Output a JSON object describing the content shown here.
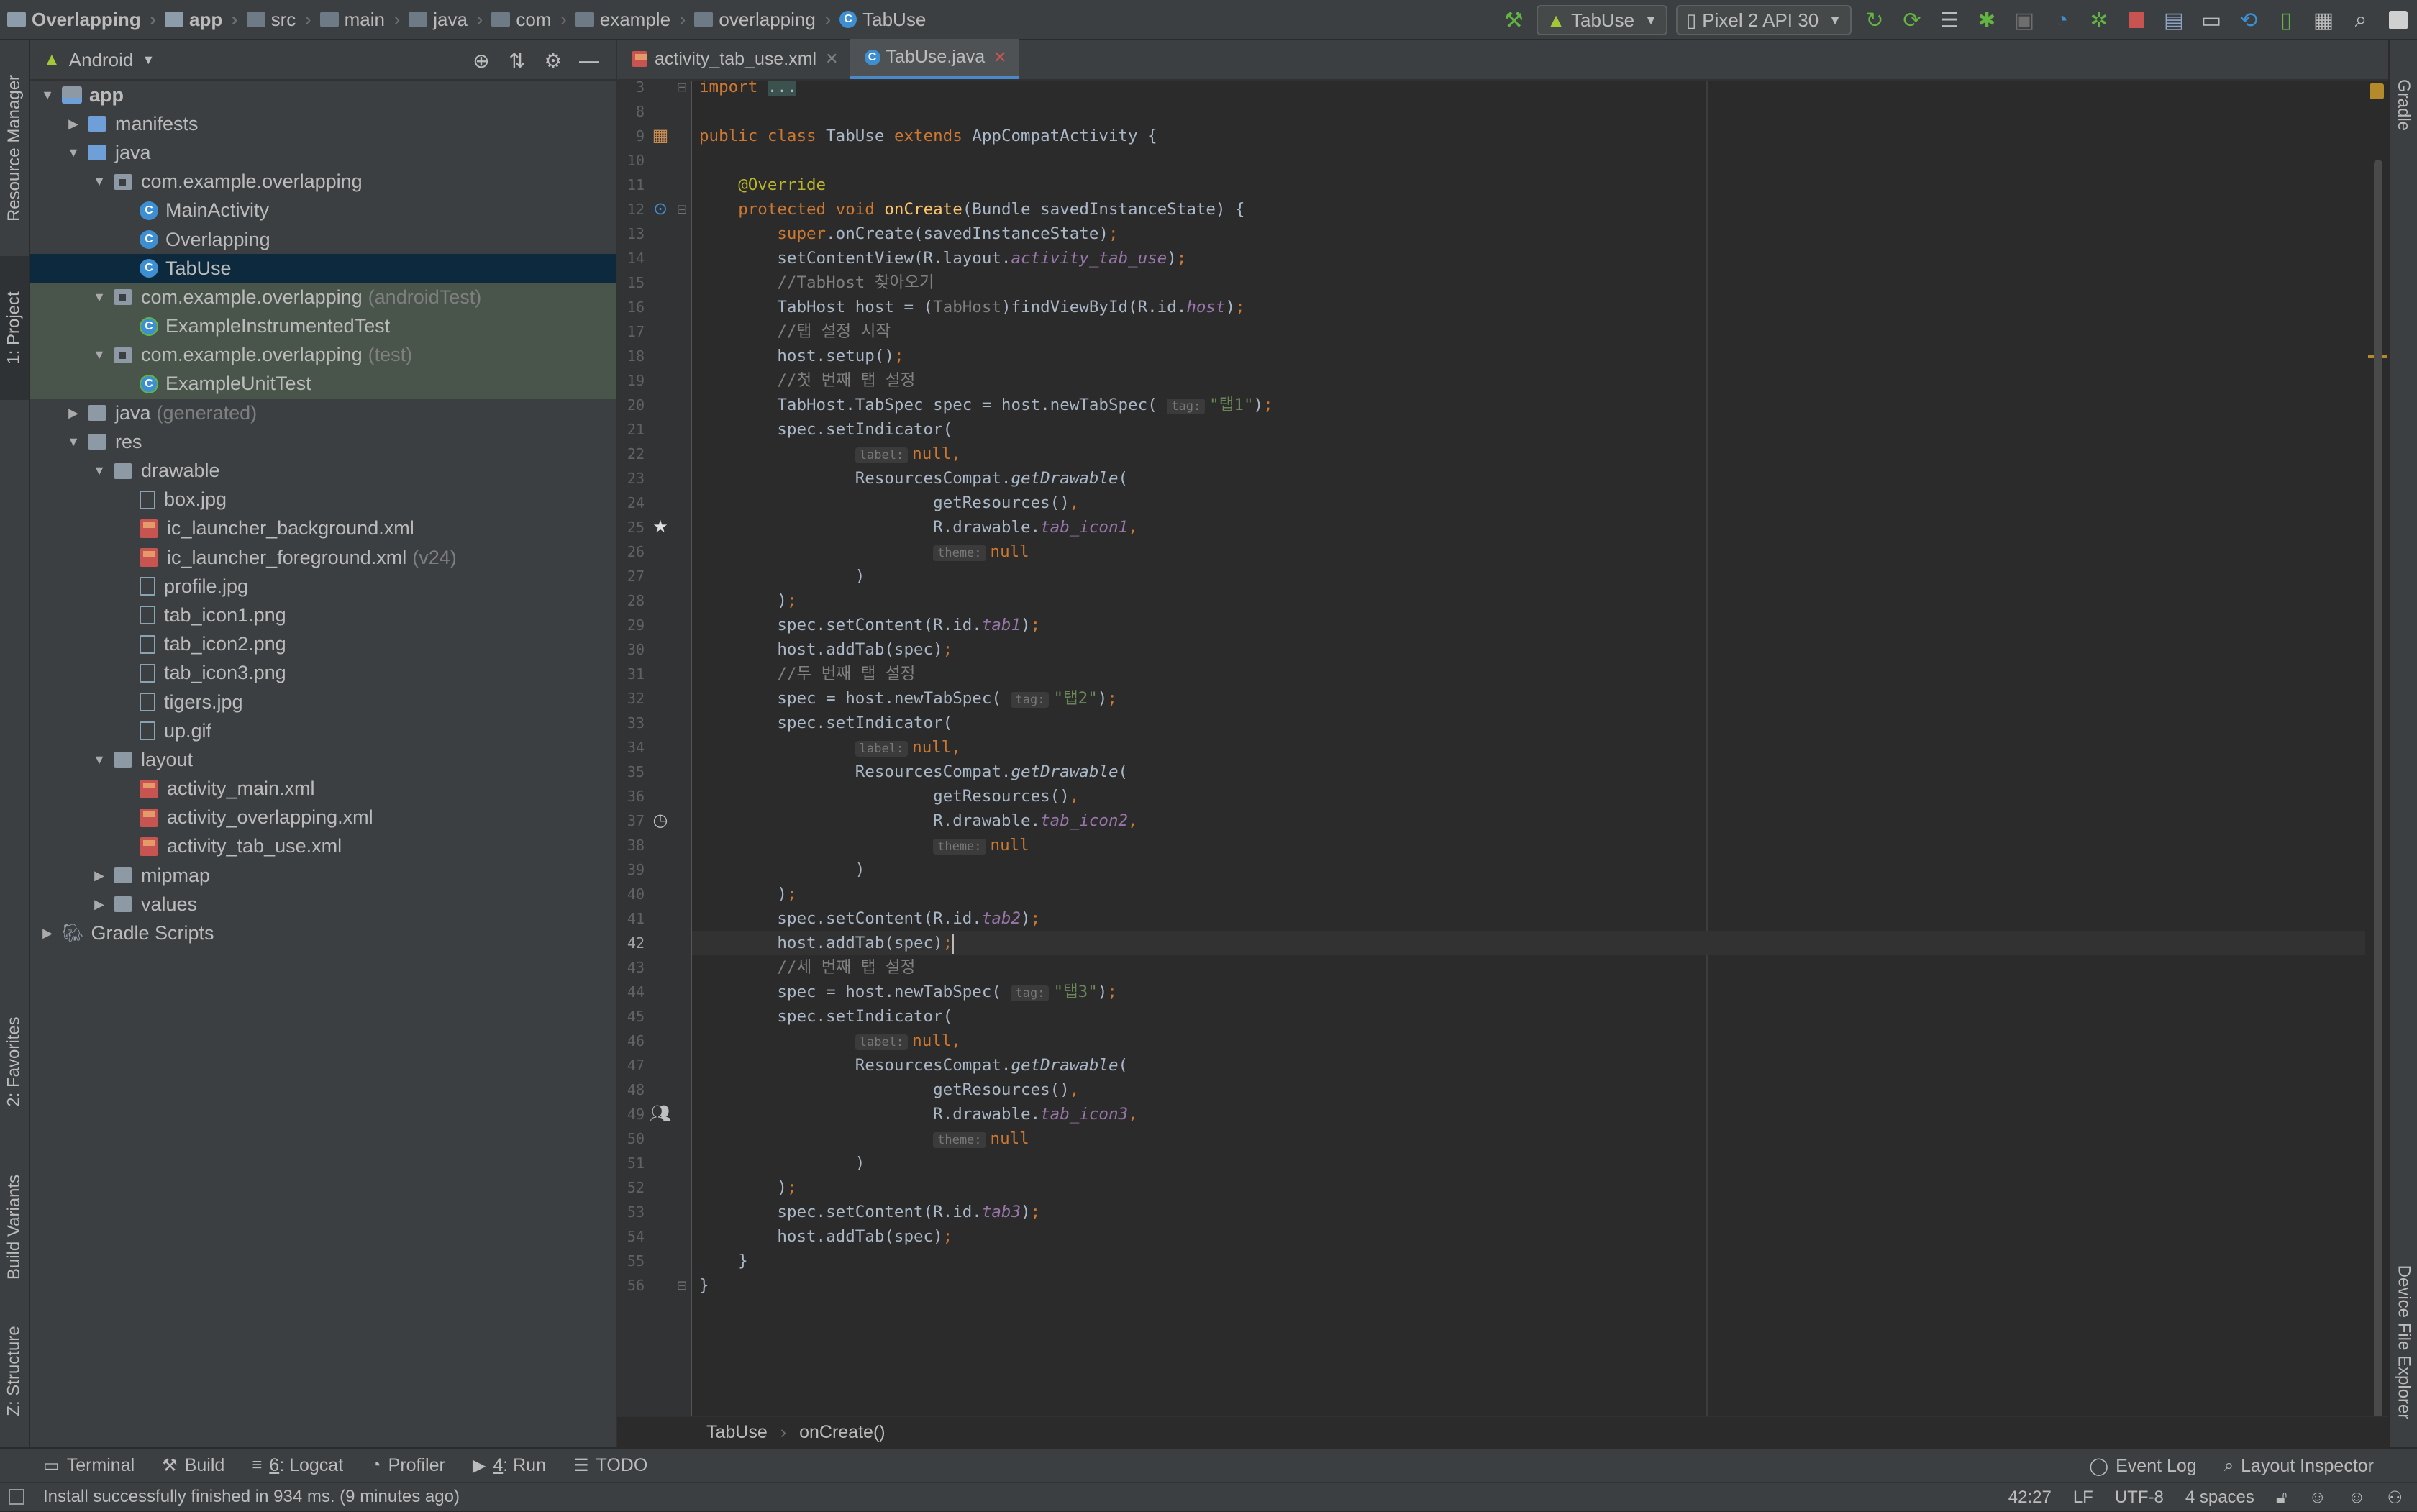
{
  "breadcrumbs": [
    {
      "label": "Overlapping",
      "icon": "project-icon",
      "bold": true
    },
    {
      "label": "app",
      "icon": "module-folder-icon",
      "bold": true
    },
    {
      "label": "src",
      "icon": "folder-icon",
      "bold": false
    },
    {
      "label": "main",
      "icon": "folder-icon",
      "bold": false
    },
    {
      "label": "java",
      "icon": "folder-icon",
      "bold": false
    },
    {
      "label": "com",
      "icon": "folder-icon",
      "bold": false
    },
    {
      "label": "example",
      "icon": "folder-icon",
      "bold": false
    },
    {
      "label": "overlapping",
      "icon": "folder-icon",
      "bold": false
    },
    {
      "label": "TabUse",
      "icon": "class-icon",
      "bold": false
    }
  ],
  "toolbar": {
    "run_config": "TabUse",
    "device": "Pixel 2 API 30"
  },
  "left_stripe": {
    "resource_manager": "Resource Manager",
    "project": "1: Project",
    "favorites": "2: Favorites",
    "build_variants": "Build Variants",
    "structure": "Z: Structure"
  },
  "project_panel": {
    "view_mode": "Android",
    "tree": [
      {
        "label": "app",
        "suffix": "",
        "depth": 0,
        "icon": "app-module",
        "expanded": "open",
        "bold": true,
        "state": ""
      },
      {
        "label": "manifests",
        "suffix": "",
        "depth": 1,
        "icon": "folder-blue",
        "expanded": "closed",
        "state": ""
      },
      {
        "label": "java",
        "suffix": "",
        "depth": 1,
        "icon": "folder-blue",
        "expanded": "open",
        "state": ""
      },
      {
        "label": "com.example.overlapping",
        "suffix": "",
        "depth": 2,
        "icon": "package",
        "expanded": "open",
        "state": ""
      },
      {
        "label": "MainActivity",
        "suffix": "",
        "depth": 3,
        "icon": "class",
        "expanded": "none",
        "state": ""
      },
      {
        "label": "Overlapping",
        "suffix": "",
        "depth": 3,
        "icon": "class",
        "expanded": "none",
        "state": ""
      },
      {
        "label": "TabUse",
        "suffix": "",
        "depth": 3,
        "icon": "class",
        "expanded": "none",
        "state": "selected"
      },
      {
        "label": "com.example.overlapping",
        "suffix": "(androidTest)",
        "depth": 2,
        "icon": "package",
        "expanded": "open",
        "state": "test"
      },
      {
        "label": "ExampleInstrumentedTest",
        "suffix": "",
        "depth": 3,
        "icon": "test-class",
        "expanded": "none",
        "state": "test"
      },
      {
        "label": "com.example.overlapping",
        "suffix": "(test)",
        "depth": 2,
        "icon": "package",
        "expanded": "open",
        "state": "test"
      },
      {
        "label": "ExampleUnitTest",
        "suffix": "",
        "depth": 3,
        "icon": "test-class",
        "expanded": "none",
        "state": "test"
      },
      {
        "label": "java",
        "suffix": "(generated)",
        "depth": 1,
        "icon": "folder-gray",
        "expanded": "closed",
        "state": ""
      },
      {
        "label": "res",
        "suffix": "",
        "depth": 1,
        "icon": "folder-gray",
        "expanded": "open",
        "state": ""
      },
      {
        "label": "drawable",
        "suffix": "",
        "depth": 2,
        "icon": "folder-gray",
        "expanded": "open",
        "state": ""
      },
      {
        "label": "box.jpg",
        "suffix": "",
        "depth": 3,
        "icon": "image",
        "expanded": "none",
        "state": ""
      },
      {
        "label": "ic_launcher_background.xml",
        "suffix": "",
        "depth": 3,
        "icon": "xml",
        "expanded": "none",
        "state": ""
      },
      {
        "label": "ic_launcher_foreground.xml",
        "suffix": "(v24)",
        "depth": 3,
        "icon": "xml",
        "expanded": "none",
        "state": ""
      },
      {
        "label": "profile.jpg",
        "suffix": "",
        "depth": 3,
        "icon": "image",
        "expanded": "none",
        "state": ""
      },
      {
        "label": "tab_icon1.png",
        "suffix": "",
        "depth": 3,
        "icon": "image",
        "expanded": "none",
        "state": ""
      },
      {
        "label": "tab_icon2.png",
        "suffix": "",
        "depth": 3,
        "icon": "image",
        "expanded": "none",
        "state": ""
      },
      {
        "label": "tab_icon3.png",
        "suffix": "",
        "depth": 3,
        "icon": "image",
        "expanded": "none",
        "state": ""
      },
      {
        "label": "tigers.jpg",
        "suffix": "",
        "depth": 3,
        "icon": "image",
        "expanded": "none",
        "state": ""
      },
      {
        "label": "up.gif",
        "suffix": "",
        "depth": 3,
        "icon": "image",
        "expanded": "none",
        "state": ""
      },
      {
        "label": "layout",
        "suffix": "",
        "depth": 2,
        "icon": "folder-gray",
        "expanded": "open",
        "state": ""
      },
      {
        "label": "activity_main.xml",
        "suffix": "",
        "depth": 3,
        "icon": "xml",
        "expanded": "none",
        "state": ""
      },
      {
        "label": "activity_overlapping.xml",
        "suffix": "",
        "depth": 3,
        "icon": "xml",
        "expanded": "none",
        "state": ""
      },
      {
        "label": "activity_tab_use.xml",
        "suffix": "",
        "depth": 3,
        "icon": "xml",
        "expanded": "none",
        "state": ""
      },
      {
        "label": "mipmap",
        "suffix": "",
        "depth": 2,
        "icon": "folder-gray",
        "expanded": "closed",
        "state": ""
      },
      {
        "label": "values",
        "suffix": "",
        "depth": 2,
        "icon": "folder-gray",
        "expanded": "closed",
        "state": ""
      },
      {
        "label": "Gradle Scripts",
        "suffix": "",
        "depth": 0,
        "icon": "gradle",
        "expanded": "closed",
        "state": ""
      }
    ]
  },
  "editor_tabs": [
    {
      "label": "activity_tab_use.xml",
      "icon": "xml-file-icon",
      "active": false
    },
    {
      "label": "TabUse.java",
      "icon": "class-icon",
      "active": true
    }
  ],
  "code": {
    "current_line": 42,
    "lines": [
      {
        "n": 3,
        "tokens": [
          [
            "kw",
            "import "
          ],
          [
            "fold",
            "..."
          ]
        ]
      },
      {
        "n": 8,
        "tokens": []
      },
      {
        "n": 9,
        "tokens": [
          [
            "kw",
            "public class "
          ],
          [
            "p",
            "TabUse "
          ],
          [
            "kw",
            "extends "
          ],
          [
            "p",
            "AppCompatActivity {"
          ]
        ]
      },
      {
        "n": 10,
        "tokens": []
      },
      {
        "n": 11,
        "tokens": [
          [
            "p",
            "    "
          ],
          [
            "ann",
            "@Override"
          ]
        ]
      },
      {
        "n": 12,
        "tokens": [
          [
            "p",
            "    "
          ],
          [
            "kw",
            "protected void "
          ],
          [
            "mth",
            "onCreate"
          ],
          [
            "p",
            "(Bundle savedInstanceState) {"
          ]
        ]
      },
      {
        "n": 13,
        "tokens": [
          [
            "p",
            "        "
          ],
          [
            "kw",
            "super"
          ],
          [
            "p",
            ".onCreate(savedInstanceState)"
          ],
          [
            "kw",
            ";"
          ]
        ]
      },
      {
        "n": 14,
        "tokens": [
          [
            "p",
            "        setContentView(R.layout."
          ],
          [
            "fld",
            "activity_tab_use"
          ],
          [
            "p",
            ")"
          ],
          [
            "kw",
            ";"
          ]
        ]
      },
      {
        "n": 15,
        "tokens": [
          [
            "p",
            "        "
          ],
          [
            "cmt",
            "//TabHost 찾아오기"
          ]
        ]
      },
      {
        "n": 16,
        "tokens": [
          [
            "p",
            "        TabHost host = ("
          ],
          [
            "cmt",
            "TabHost"
          ],
          [
            "p",
            ")findViewById(R.id."
          ],
          [
            "fld",
            "host"
          ],
          [
            "p",
            ")"
          ],
          [
            "kw",
            ";"
          ]
        ]
      },
      {
        "n": 17,
        "tokens": [
          [
            "p",
            "        "
          ],
          [
            "cmt",
            "//탭 설정 시작"
          ]
        ]
      },
      {
        "n": 18,
        "tokens": [
          [
            "p",
            "        host.setup()"
          ],
          [
            "kw",
            ";"
          ]
        ]
      },
      {
        "n": 19,
        "tokens": [
          [
            "p",
            "        "
          ],
          [
            "cmt",
            "//첫 번째 탭 설정"
          ]
        ]
      },
      {
        "n": 20,
        "tokens": [
          [
            "p",
            "        TabHost.TabSpec spec = host.newTabSpec( "
          ],
          [
            "hint",
            "tag:"
          ],
          [
            "str",
            "\"탭1\""
          ],
          [
            "p",
            ")"
          ],
          [
            "kw",
            ";"
          ]
        ]
      },
      {
        "n": 21,
        "tokens": [
          [
            "p",
            "        spec.setIndicator("
          ]
        ]
      },
      {
        "n": 22,
        "tokens": [
          [
            "p",
            "                "
          ],
          [
            "hint",
            "label:"
          ],
          [
            "kw",
            "null,"
          ]
        ]
      },
      {
        "n": 23,
        "tokens": [
          [
            "p",
            "                ResourcesCompat."
          ],
          [
            "sfn",
            "getDrawable"
          ],
          [
            "p",
            "("
          ]
        ]
      },
      {
        "n": 24,
        "tokens": [
          [
            "p",
            "                        getResources()"
          ],
          [
            "kw",
            ","
          ]
        ]
      },
      {
        "n": 25,
        "tokens": [
          [
            "p",
            "                        R.drawable."
          ],
          [
            "fld",
            "tab_icon1"
          ],
          [
            "kw",
            ","
          ]
        ]
      },
      {
        "n": 26,
        "tokens": [
          [
            "p",
            "                        "
          ],
          [
            "hint",
            "theme:"
          ],
          [
            "kw",
            "null"
          ]
        ]
      },
      {
        "n": 27,
        "tokens": [
          [
            "p",
            "                )"
          ]
        ]
      },
      {
        "n": 28,
        "tokens": [
          [
            "p",
            "        )"
          ],
          [
            "kw",
            ";"
          ]
        ]
      },
      {
        "n": 29,
        "tokens": [
          [
            "p",
            "        spec.setContent(R.id."
          ],
          [
            "fld",
            "tab1"
          ],
          [
            "p",
            ")"
          ],
          [
            "kw",
            ";"
          ]
        ]
      },
      {
        "n": 30,
        "tokens": [
          [
            "p",
            "        host.addTab(spec)"
          ],
          [
            "kw",
            ";"
          ]
        ]
      },
      {
        "n": 31,
        "tokens": [
          [
            "p",
            "        "
          ],
          [
            "cmt",
            "//두 번째 탭 설정"
          ]
        ]
      },
      {
        "n": 32,
        "tokens": [
          [
            "p",
            "        spec = host.newTabSpec( "
          ],
          [
            "hint",
            "tag:"
          ],
          [
            "str",
            "\"탭2\""
          ],
          [
            "p",
            ")"
          ],
          [
            "kw",
            ";"
          ]
        ]
      },
      {
        "n": 33,
        "tokens": [
          [
            "p",
            "        spec.setIndicator("
          ]
        ]
      },
      {
        "n": 34,
        "tokens": [
          [
            "p",
            "                "
          ],
          [
            "hint",
            "label:"
          ],
          [
            "kw",
            "null,"
          ]
        ]
      },
      {
        "n": 35,
        "tokens": [
          [
            "p",
            "                ResourcesCompat."
          ],
          [
            "sfn",
            "getDrawable"
          ],
          [
            "p",
            "("
          ]
        ]
      },
      {
        "n": 36,
        "tokens": [
          [
            "p",
            "                        getResources()"
          ],
          [
            "kw",
            ","
          ]
        ]
      },
      {
        "n": 37,
        "tokens": [
          [
            "p",
            "                        R.drawable."
          ],
          [
            "fld",
            "tab_icon2"
          ],
          [
            "kw",
            ","
          ]
        ]
      },
      {
        "n": 38,
        "tokens": [
          [
            "p",
            "                        "
          ],
          [
            "hint",
            "theme:"
          ],
          [
            "kw",
            "null"
          ]
        ]
      },
      {
        "n": 39,
        "tokens": [
          [
            "p",
            "                )"
          ]
        ]
      },
      {
        "n": 40,
        "tokens": [
          [
            "p",
            "        )"
          ],
          [
            "kw",
            ";"
          ]
        ]
      },
      {
        "n": 41,
        "tokens": [
          [
            "p",
            "        spec.setContent(R.id."
          ],
          [
            "fld",
            "tab2"
          ],
          [
            "p",
            ")"
          ],
          [
            "kw",
            ";"
          ]
        ]
      },
      {
        "n": 42,
        "tokens": [
          [
            "p",
            "        host.addTab(spec)"
          ],
          [
            "kw",
            ";"
          ],
          [
            "caret",
            ""
          ]
        ]
      },
      {
        "n": 43,
        "tokens": [
          [
            "p",
            "        "
          ],
          [
            "cmt",
            "//세 번째 탭 설정"
          ]
        ]
      },
      {
        "n": 44,
        "tokens": [
          [
            "p",
            "        spec = host.newTabSpec( "
          ],
          [
            "hint",
            "tag:"
          ],
          [
            "str",
            "\"탭3\""
          ],
          [
            "p",
            ")"
          ],
          [
            "kw",
            ";"
          ]
        ]
      },
      {
        "n": 45,
        "tokens": [
          [
            "p",
            "        spec.setIndicator("
          ]
        ]
      },
      {
        "n": 46,
        "tokens": [
          [
            "p",
            "                "
          ],
          [
            "hint",
            "label:"
          ],
          [
            "kw",
            "null,"
          ]
        ]
      },
      {
        "n": 47,
        "tokens": [
          [
            "p",
            "                ResourcesCompat."
          ],
          [
            "sfn",
            "getDrawable"
          ],
          [
            "p",
            "("
          ]
        ]
      },
      {
        "n": 48,
        "tokens": [
          [
            "p",
            "                        getResources()"
          ],
          [
            "kw",
            ","
          ]
        ]
      },
      {
        "n": 49,
        "tokens": [
          [
            "p",
            "                        R.drawable."
          ],
          [
            "fld",
            "tab_icon3"
          ],
          [
            "kw",
            ","
          ]
        ]
      },
      {
        "n": 50,
        "tokens": [
          [
            "p",
            "                        "
          ],
          [
            "hint",
            "theme:"
          ],
          [
            "kw",
            "null"
          ]
        ]
      },
      {
        "n": 51,
        "tokens": [
          [
            "p",
            "                )"
          ]
        ]
      },
      {
        "n": 52,
        "tokens": [
          [
            "p",
            "        )"
          ],
          [
            "kw",
            ";"
          ]
        ]
      },
      {
        "n": 53,
        "tokens": [
          [
            "p",
            "        spec.setContent(R.id."
          ],
          [
            "fld",
            "tab3"
          ],
          [
            "p",
            ")"
          ],
          [
            "kw",
            ";"
          ]
        ]
      },
      {
        "n": 54,
        "tokens": [
          [
            "p",
            "        host.addTab(spec)"
          ],
          [
            "kw",
            ";"
          ]
        ]
      },
      {
        "n": 55,
        "tokens": [
          [
            "p",
            "    }"
          ]
        ]
      },
      {
        "n": 56,
        "tokens": [
          [
            "p",
            "}"
          ]
        ]
      }
    ]
  },
  "gutter_marks": [
    {
      "line": 9,
      "icon": "android-layout-icon"
    },
    {
      "line": 12,
      "icon": "override-method-icon"
    },
    {
      "line": 25,
      "icon": "star-icon"
    },
    {
      "line": 37,
      "icon": "clock-icon"
    },
    {
      "line": 49,
      "icon": "people-icon"
    }
  ],
  "editor_breadcrumb": [
    "TabUse",
    "onCreate()"
  ],
  "right_stripe": {
    "gradle": "Gradle",
    "device_file_explorer": "Device File Explorer"
  },
  "bottom_tools": {
    "terminal": "Terminal",
    "build": "Build",
    "logcat_num": "6",
    "logcat": ": Logcat",
    "profiler": "Profiler",
    "run_num": "4",
    "run": ": Run",
    "todo": "TODO",
    "event_log": "Event Log",
    "layout_inspector": "Layout Inspector"
  },
  "status": {
    "message": "Install successfully finished in 934 ms. (9 minutes ago)",
    "position": "42:27",
    "line_sep": "LF",
    "encoding": "UTF-8",
    "indent": "4 spaces"
  },
  "colors": {
    "background": "#2b2b2b",
    "panel": "#3c3f41",
    "selection": "#0d293e",
    "test_source": "#49544a",
    "keyword": "#cc7832",
    "string": "#6a8759",
    "annotation": "#bbb529",
    "field": "#9876aa",
    "method": "#ffc66d",
    "comment": "#808080"
  }
}
